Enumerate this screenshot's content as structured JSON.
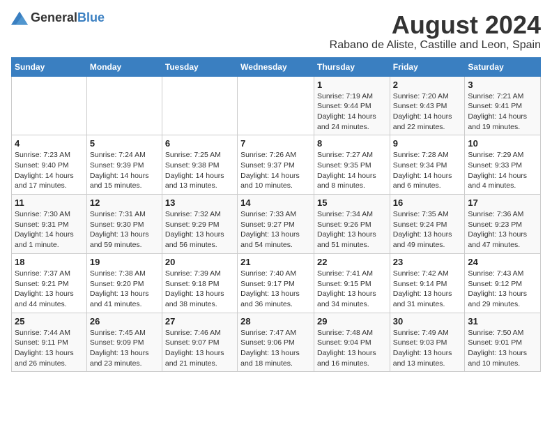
{
  "logo": {
    "text_general": "General",
    "text_blue": "Blue"
  },
  "title": "August 2024",
  "subtitle": "Rabano de Aliste, Castille and Leon, Spain",
  "headers": [
    "Sunday",
    "Monday",
    "Tuesday",
    "Wednesday",
    "Thursday",
    "Friday",
    "Saturday"
  ],
  "weeks": [
    [
      {
        "day": "",
        "info": ""
      },
      {
        "day": "",
        "info": ""
      },
      {
        "day": "",
        "info": ""
      },
      {
        "day": "",
        "info": ""
      },
      {
        "day": "1",
        "info": "Sunrise: 7:19 AM\nSunset: 9:44 PM\nDaylight: 14 hours and 24 minutes."
      },
      {
        "day": "2",
        "info": "Sunrise: 7:20 AM\nSunset: 9:43 PM\nDaylight: 14 hours and 22 minutes."
      },
      {
        "day": "3",
        "info": "Sunrise: 7:21 AM\nSunset: 9:41 PM\nDaylight: 14 hours and 19 minutes."
      }
    ],
    [
      {
        "day": "4",
        "info": "Sunrise: 7:23 AM\nSunset: 9:40 PM\nDaylight: 14 hours and 17 minutes."
      },
      {
        "day": "5",
        "info": "Sunrise: 7:24 AM\nSunset: 9:39 PM\nDaylight: 14 hours and 15 minutes."
      },
      {
        "day": "6",
        "info": "Sunrise: 7:25 AM\nSunset: 9:38 PM\nDaylight: 14 hours and 13 minutes."
      },
      {
        "day": "7",
        "info": "Sunrise: 7:26 AM\nSunset: 9:37 PM\nDaylight: 14 hours and 10 minutes."
      },
      {
        "day": "8",
        "info": "Sunrise: 7:27 AM\nSunset: 9:35 PM\nDaylight: 14 hours and 8 minutes."
      },
      {
        "day": "9",
        "info": "Sunrise: 7:28 AM\nSunset: 9:34 PM\nDaylight: 14 hours and 6 minutes."
      },
      {
        "day": "10",
        "info": "Sunrise: 7:29 AM\nSunset: 9:33 PM\nDaylight: 14 hours and 4 minutes."
      }
    ],
    [
      {
        "day": "11",
        "info": "Sunrise: 7:30 AM\nSunset: 9:31 PM\nDaylight: 14 hours and 1 minute."
      },
      {
        "day": "12",
        "info": "Sunrise: 7:31 AM\nSunset: 9:30 PM\nDaylight: 13 hours and 59 minutes."
      },
      {
        "day": "13",
        "info": "Sunrise: 7:32 AM\nSunset: 9:29 PM\nDaylight: 13 hours and 56 minutes."
      },
      {
        "day": "14",
        "info": "Sunrise: 7:33 AM\nSunset: 9:27 PM\nDaylight: 13 hours and 54 minutes."
      },
      {
        "day": "15",
        "info": "Sunrise: 7:34 AM\nSunset: 9:26 PM\nDaylight: 13 hours and 51 minutes."
      },
      {
        "day": "16",
        "info": "Sunrise: 7:35 AM\nSunset: 9:24 PM\nDaylight: 13 hours and 49 minutes."
      },
      {
        "day": "17",
        "info": "Sunrise: 7:36 AM\nSunset: 9:23 PM\nDaylight: 13 hours and 47 minutes."
      }
    ],
    [
      {
        "day": "18",
        "info": "Sunrise: 7:37 AM\nSunset: 9:21 PM\nDaylight: 13 hours and 44 minutes."
      },
      {
        "day": "19",
        "info": "Sunrise: 7:38 AM\nSunset: 9:20 PM\nDaylight: 13 hours and 41 minutes."
      },
      {
        "day": "20",
        "info": "Sunrise: 7:39 AM\nSunset: 9:18 PM\nDaylight: 13 hours and 38 minutes."
      },
      {
        "day": "21",
        "info": "Sunrise: 7:40 AM\nSunset: 9:17 PM\nDaylight: 13 hours and 36 minutes."
      },
      {
        "day": "22",
        "info": "Sunrise: 7:41 AM\nSunset: 9:15 PM\nDaylight: 13 hours and 34 minutes."
      },
      {
        "day": "23",
        "info": "Sunrise: 7:42 AM\nSunset: 9:14 PM\nDaylight: 13 hours and 31 minutes."
      },
      {
        "day": "24",
        "info": "Sunrise: 7:43 AM\nSunset: 9:12 PM\nDaylight: 13 hours and 29 minutes."
      }
    ],
    [
      {
        "day": "25",
        "info": "Sunrise: 7:44 AM\nSunset: 9:11 PM\nDaylight: 13 hours and 26 minutes."
      },
      {
        "day": "26",
        "info": "Sunrise: 7:45 AM\nSunset: 9:09 PM\nDaylight: 13 hours and 23 minutes."
      },
      {
        "day": "27",
        "info": "Sunrise: 7:46 AM\nSunset: 9:07 PM\nDaylight: 13 hours and 21 minutes."
      },
      {
        "day": "28",
        "info": "Sunrise: 7:47 AM\nSunset: 9:06 PM\nDaylight: 13 hours and 18 minutes."
      },
      {
        "day": "29",
        "info": "Sunrise: 7:48 AM\nSunset: 9:04 PM\nDaylight: 13 hours and 16 minutes."
      },
      {
        "day": "30",
        "info": "Sunrise: 7:49 AM\nSunset: 9:03 PM\nDaylight: 13 hours and 13 minutes."
      },
      {
        "day": "31",
        "info": "Sunrise: 7:50 AM\nSunset: 9:01 PM\nDaylight: 13 hours and 10 minutes."
      }
    ]
  ]
}
